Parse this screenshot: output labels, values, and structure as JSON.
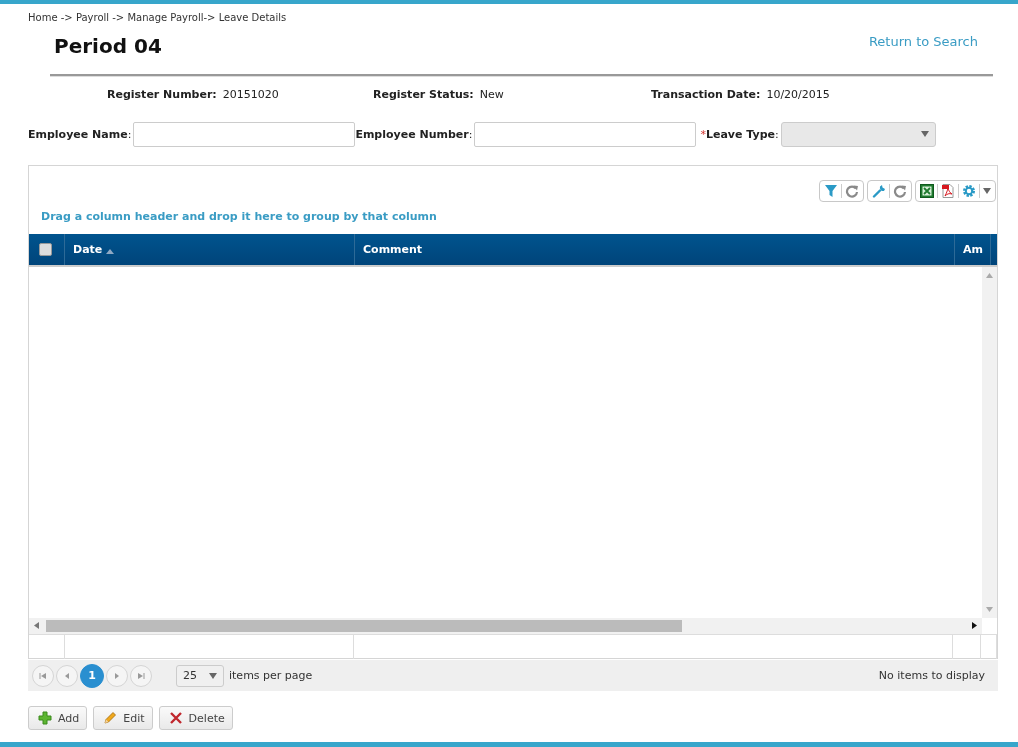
{
  "breadcrumb": "Home -> Payroll -> Manage Payroll-> Leave Details",
  "title": "Period 04",
  "return_link": "Return to Search",
  "register_info": [
    {
      "label": "Register Number:",
      "value": "20151020"
    },
    {
      "label": "Register Status:",
      "value": "New"
    },
    {
      "label": "Transaction Date:",
      "value": "10/20/2015"
    }
  ],
  "filters": [
    {
      "kind": "text",
      "label": "Employee Name",
      "separator": ":",
      "disabled": false
    },
    {
      "kind": "text",
      "label": "Employee Number",
      "separator": ":",
      "disabled": false
    },
    {
      "kind": "select",
      "required_mark": "*",
      "label": "Leave Type",
      "separator": ":",
      "disabled": true
    }
  ],
  "grid": {
    "group_hint": "Drag a column header and drop it here to group by that column",
    "select_all": {
      "checked": false
    },
    "columns": [
      {
        "label": "Date",
        "sorted": true
      },
      {
        "label": "Comment",
        "sorted": false
      },
      {
        "label": "Am",
        "sorted": false
      }
    ],
    "page_size": "25",
    "items_per_page": "items per page",
    "status": "No items to display",
    "pages": [
      {
        "label": "1",
        "selected": true
      }
    ]
  },
  "buttons": [
    {
      "kind": "add",
      "label": "Add"
    },
    {
      "kind": "edit",
      "label": "Edit"
    },
    {
      "kind": "delete",
      "label": "Delete"
    }
  ]
}
